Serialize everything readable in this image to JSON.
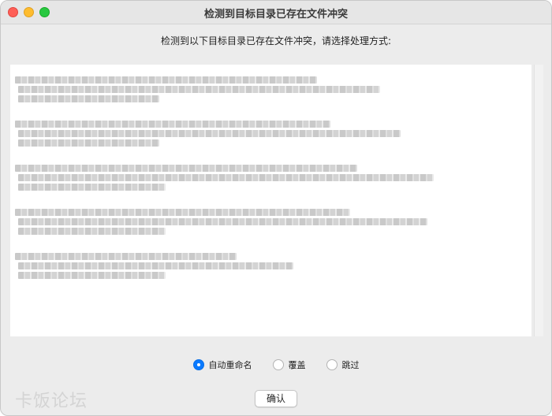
{
  "window": {
    "title": "检测到目标目录已存在文件冲突"
  },
  "prompt": "检测到以下目标目录已存在文件冲突，请选择处理方式:",
  "conflicts": [
    {
      "lines": [
        "■■■■■■■■■■■■■■■■■■■■■■■■■■■■■■■■■■■■■■■■■■■■■",
        "■■■■■■■■■■■■■■■■■■■■■■■■■■■■■■■■■■■■■■■■■■■■■■■■■■■■■■",
        "■■■■■■■■■■■■■■■■■■■■■"
      ]
    },
    {
      "lines": [
        "■■■■■■■■■■■■■■■■■■■■■■■■■■■■■■■■■■■■■■■■■■■■■■■",
        "■■■■■■■■■■■■■■■■■■■■■■■■■■■■■■■■■■■■■■■■■■■■■■■■■■■■■■■■■",
        "■■■■■■■■■■■■■■■■■■■■■"
      ]
    },
    {
      "lines": [
        "■■■■■■■■■■■■■■■■■■■■■■■■■■■■■■■■■■■■■■■■■■■■■■■■■■■",
        "■■■■■■■■■■■■■■■■■■■■■■■■■■■■■■■■■■■■■■■■■■■■■■■■■■■■■■■■■■■■■■",
        "■■■■■■■■■■■■■■■■■■■■■■"
      ]
    },
    {
      "lines": [
        "■■■■■■■■■■■■■■■■■■■■■■■■■■■■■■■■■■■■■■■■■■■■■■■■■■",
        "■■■■■■■■■■■■■■■■■■■■■■■■■■■■■■■■■■■■■■■■■■■■■■■■■■■■■■■■■■■■■",
        "■■■■■■■■■■■■■■■■■■■■■■"
      ]
    },
    {
      "lines": [
        "■■■■■■■■■■■■■■■■■■■■■■■■■■■■■■■■■",
        "■■■■■■■■■■■■■■■■■■■■■■■■■■■■■■■■■■■■■■■■■",
        "■■■■■■■■■■■■■■■■■■■■■■"
      ]
    }
  ],
  "options": [
    {
      "label": "自动重命名",
      "checked": true
    },
    {
      "label": "覆盖",
      "checked": false
    },
    {
      "label": "跳过",
      "checked": false
    }
  ],
  "confirm_label": "确认",
  "watermark": "卡饭论坛",
  "colors": {
    "accent": "#0a7aff",
    "close": "#fe5f57",
    "minimize": "#febc2e",
    "maximize": "#28c840"
  }
}
